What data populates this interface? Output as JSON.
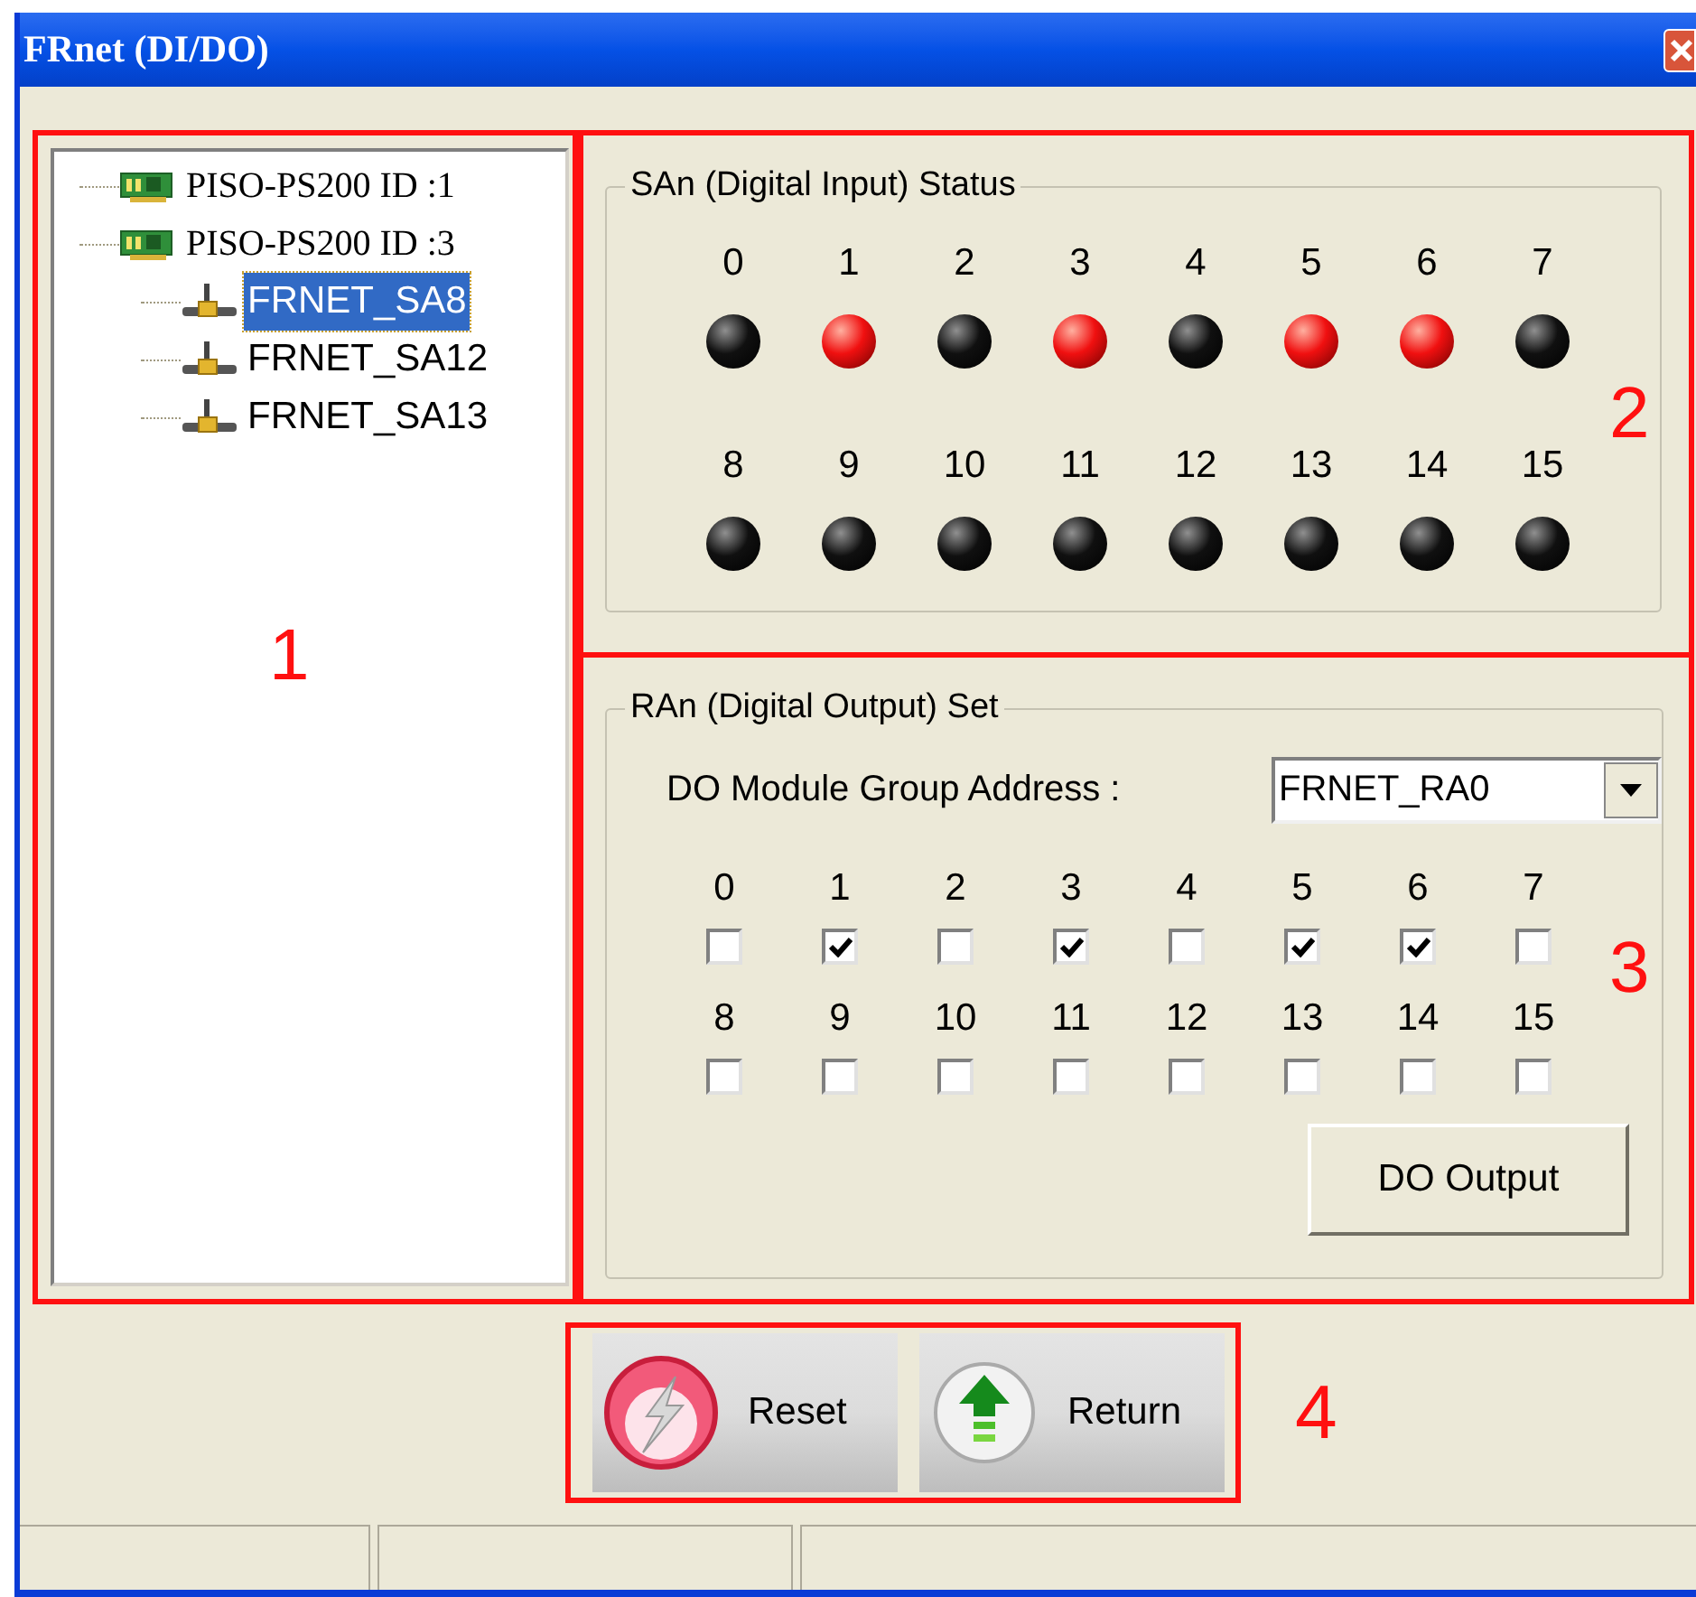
{
  "window": {
    "title": "FRnet (DI/DO)"
  },
  "tree": [
    {
      "label": "PISO-PS200 ID :1",
      "kind": "card",
      "selected": false
    },
    {
      "label": "PISO-PS200 ID :3",
      "kind": "card",
      "selected": false,
      "children": [
        {
          "label": "FRNET_SA8",
          "kind": "node",
          "selected": true
        },
        {
          "label": "FRNET_SA12",
          "kind": "node",
          "selected": false
        },
        {
          "label": "FRNET_SA13",
          "kind": "node",
          "selected": false
        }
      ]
    }
  ],
  "di_group": {
    "title": "SAn (Digital Input) Status",
    "channels": [
      {
        "label": "0",
        "on": false
      },
      {
        "label": "1",
        "on": true
      },
      {
        "label": "2",
        "on": false
      },
      {
        "label": "3",
        "on": true
      },
      {
        "label": "4",
        "on": false
      },
      {
        "label": "5",
        "on": true
      },
      {
        "label": "6",
        "on": true
      },
      {
        "label": "7",
        "on": false
      },
      {
        "label": "8",
        "on": false
      },
      {
        "label": "9",
        "on": false
      },
      {
        "label": "10",
        "on": false
      },
      {
        "label": "11",
        "on": false
      },
      {
        "label": "12",
        "on": false
      },
      {
        "label": "13",
        "on": false
      },
      {
        "label": "14",
        "on": false
      },
      {
        "label": "15",
        "on": false
      }
    ]
  },
  "do_group": {
    "title": "RAn (Digital Output) Set",
    "address_label": "DO Module Group Address :",
    "address_value": "FRNET_RA0",
    "channels": [
      {
        "label": "0",
        "checked": false
      },
      {
        "label": "1",
        "checked": true
      },
      {
        "label": "2",
        "checked": false
      },
      {
        "label": "3",
        "checked": true
      },
      {
        "label": "4",
        "checked": false
      },
      {
        "label": "5",
        "checked": true
      },
      {
        "label": "6",
        "checked": true
      },
      {
        "label": "7",
        "checked": false
      },
      {
        "label": "8",
        "checked": false
      },
      {
        "label": "9",
        "checked": false
      },
      {
        "label": "10",
        "checked": false
      },
      {
        "label": "11",
        "checked": false
      },
      {
        "label": "12",
        "checked": false
      },
      {
        "label": "13",
        "checked": false
      },
      {
        "label": "14",
        "checked": false
      },
      {
        "label": "15",
        "checked": false
      }
    ],
    "output_button": "DO Output"
  },
  "buttons": [
    {
      "label": "Reset",
      "kind": "reset"
    },
    {
      "label": "Return",
      "kind": "return"
    }
  ],
  "annotations": [
    "1",
    "2",
    "3",
    "4"
  ]
}
